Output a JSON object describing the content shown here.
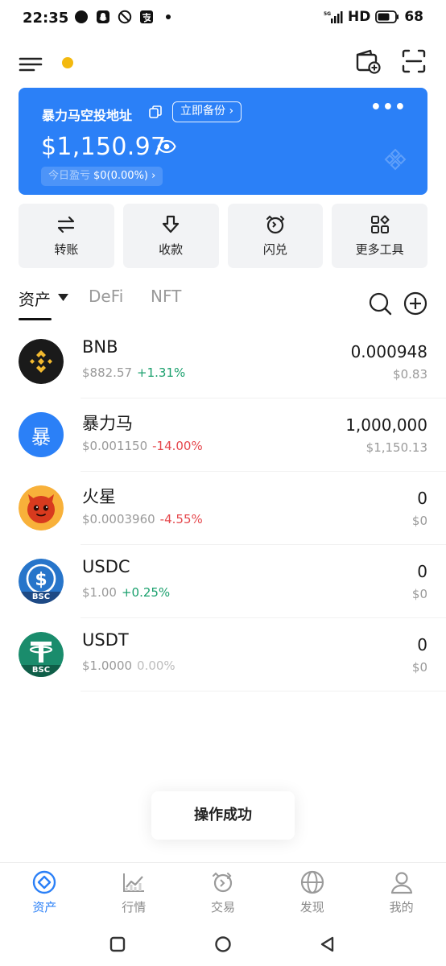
{
  "status_bar": {
    "time": "22:35",
    "network": "HD",
    "battery": "68",
    "notification_icons": [
      "chat-bubble-icon",
      "snapchat-icon",
      "blocked-icon",
      "alipay-icon",
      "dot-icon"
    ]
  },
  "header": {
    "notification_dot_color": "#f3b90f"
  },
  "wallet_card": {
    "title": "暴力马空投地址",
    "backup_label": "立即备份",
    "more_label": "•••",
    "balance": "$1,150.97",
    "pnl_label": "今日盈亏",
    "pnl_value": "$0(0.00%)",
    "background_color": "#2b80f7"
  },
  "actions": [
    {
      "label": "转账",
      "icon": "transfer-icon"
    },
    {
      "label": "收款",
      "icon": "receive-icon"
    },
    {
      "label": "闪兑",
      "icon": "swap-icon"
    },
    {
      "label": "更多工具",
      "icon": "tools-icon"
    }
  ],
  "tabs": [
    {
      "label": "资产",
      "active": true
    },
    {
      "label": "DeFi",
      "active": false
    },
    {
      "label": "NFT",
      "active": false
    }
  ],
  "tokens": [
    {
      "name": "BNB",
      "price": "$882.57",
      "change": "+1.31%",
      "trend": "up",
      "amount": "0.000948",
      "value": "$0.83",
      "icon": "bnb-icon"
    },
    {
      "name": "暴力马",
      "price": "$0.001150",
      "change": "-14.00%",
      "trend": "down",
      "amount": "1,000,000",
      "value": "$1,150.13",
      "icon": "baolima-icon",
      "icon_text": "暴"
    },
    {
      "name": "火星",
      "price": "$0.0003960",
      "change": "-4.55%",
      "trend": "down",
      "amount": "0",
      "value": "$0",
      "icon": "mars-devil-icon"
    },
    {
      "name": "USDC",
      "price": "$1.00",
      "change": "+0.25%",
      "trend": "up",
      "amount": "0",
      "value": "$0",
      "icon": "usdc-icon",
      "badge": "BSC"
    },
    {
      "name": "USDT",
      "price": "$1.0000",
      "change": "0.00%",
      "trend": "flat",
      "amount": "0",
      "value": "$0",
      "icon": "usdt-icon",
      "badge": "BSC"
    }
  ],
  "toast": {
    "message": "操作成功"
  },
  "bottom_nav": [
    {
      "label": "资产",
      "icon": "assets-icon",
      "active": true
    },
    {
      "label": "行情",
      "icon": "market-icon",
      "active": false
    },
    {
      "label": "交易",
      "icon": "trade-icon",
      "active": false
    },
    {
      "label": "发现",
      "icon": "discover-icon",
      "active": false
    },
    {
      "label": "我的",
      "icon": "profile-icon",
      "active": false
    }
  ],
  "colors": {
    "accent": "#2b80f7",
    "up": "#1aa06d",
    "down": "#e5484d"
  }
}
